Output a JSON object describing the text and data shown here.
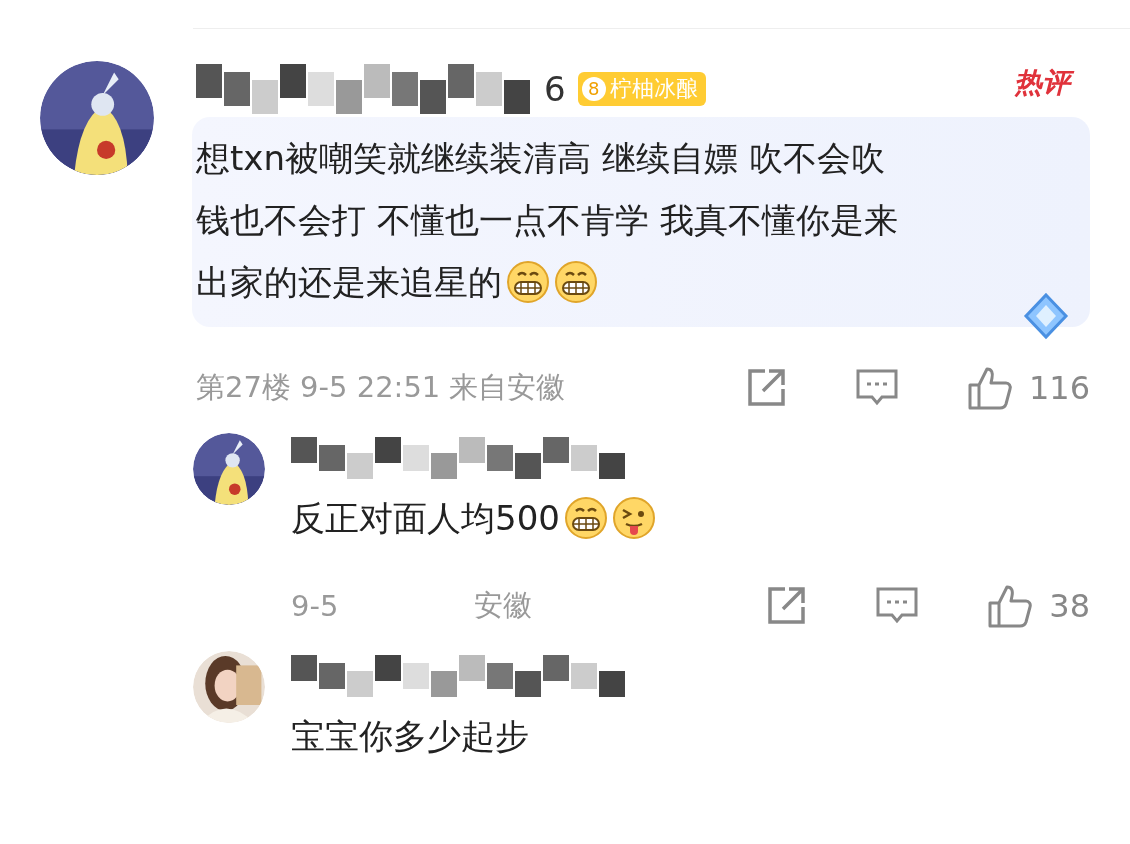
{
  "comments": [
    {
      "kind": "main",
      "name_tail": "6",
      "badge": {
        "level": "8",
        "label": "柠柚冰酿"
      },
      "hot_tag": "热评",
      "lines": [
        "想txn被嘲笑就继续装清高 继续自嫖 吹不会吹",
        "钱也不会打 不懂也一点不肯学 我真不懂你是来",
        "出家的还是来追星的"
      ],
      "emojis": [
        {
          "kind": "grin"
        },
        {
          "kind": "grin"
        }
      ],
      "meta": [
        "第27楼 9-5 22:51 来自安徽"
      ],
      "likes": "116"
    },
    {
      "kind": "reply",
      "lines": [
        "反正对面人均500"
      ],
      "emojis": [
        {
          "kind": "grin"
        },
        {
          "kind": "tongue"
        }
      ],
      "meta": [
        "9-5",
        "安徽"
      ],
      "likes": "38"
    },
    {
      "kind": "reply",
      "lines": [
        "宝宝你多少起步"
      ]
    }
  ]
}
